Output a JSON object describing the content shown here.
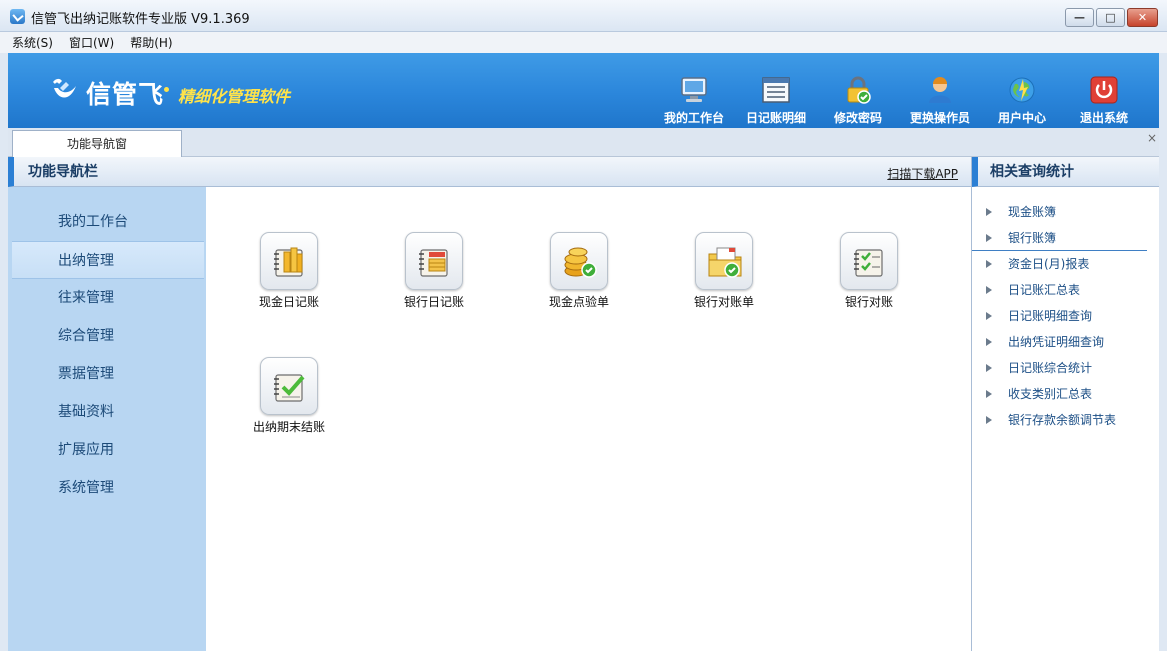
{
  "window": {
    "title": "信管飞出纳记账软件专业版 V9.1.369",
    "buttons": {
      "minimize": "—",
      "maximize": "□",
      "close": "✕"
    }
  },
  "menu": [
    "系统(S)",
    "窗口(W)",
    "帮助(H)"
  ],
  "banner": {
    "logo": "信管飞",
    "slogan": "精细化管理软件",
    "tools": [
      {
        "label": "我的工作台",
        "icon": "monitor-icon"
      },
      {
        "label": "日记账明细",
        "icon": "list-icon"
      },
      {
        "label": "修改密码",
        "icon": "lock-icon"
      },
      {
        "label": "更换操作员",
        "icon": "user-icon"
      },
      {
        "label": "用户中心",
        "icon": "globe-icon"
      },
      {
        "label": "退出系统",
        "icon": "power-icon"
      }
    ]
  },
  "tabs": {
    "active": "功能导航窗",
    "close": "×"
  },
  "left_nav": {
    "title": "功能导航栏",
    "items": [
      "我的工作台",
      "出纳管理",
      "往来管理",
      "综合管理",
      "票据管理",
      "基础资料",
      "扩展应用",
      "系统管理"
    ],
    "active_index": 1
  },
  "center": {
    "scan_link": "扫描下载APP",
    "functions": [
      {
        "label": "现金日记账",
        "icon": "cash-journal-icon"
      },
      {
        "label": "银行日记账",
        "icon": "bank-journal-icon"
      },
      {
        "label": "现金点验单",
        "icon": "coin-check-icon"
      },
      {
        "label": "银行对账单",
        "icon": "folder-check-icon"
      },
      {
        "label": "银行对账",
        "icon": "notebook-check-icon"
      },
      {
        "label": "出纳期末结账",
        "icon": "period-close-icon"
      }
    ]
  },
  "right_panel": {
    "title": "相关查询统计",
    "items": [
      "现金账簿",
      "银行账簿",
      "资金日(月)报表",
      "日记账汇总表",
      "日记账明细查询",
      "出纳凭证明细查询",
      "日记账综合统计",
      "收支类别汇总表",
      "银行存款余额调节表"
    ],
    "selected_index": 1
  }
}
